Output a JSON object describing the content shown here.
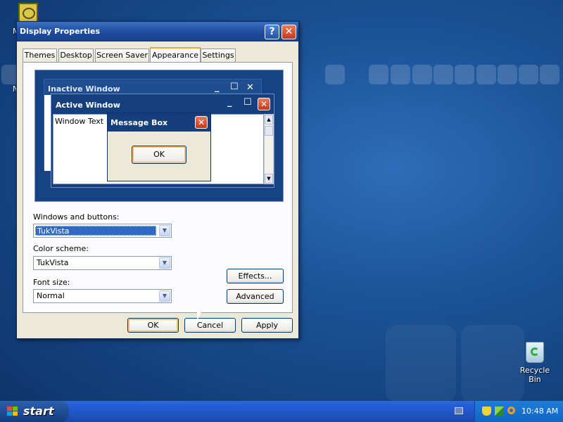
{
  "desktop": {
    "icons": [
      {
        "label": "M"
      },
      {
        "label": "N"
      }
    ],
    "recycle_bin": {
      "label": "Recycle Bin"
    }
  },
  "dialog": {
    "title": "Display Properties",
    "tabs": [
      {
        "label": "Themes"
      },
      {
        "label": "Desktop"
      },
      {
        "label": "Screen Saver"
      },
      {
        "label": "Appearance"
      },
      {
        "label": "Settings"
      }
    ],
    "active_tab": "Appearance",
    "preview": {
      "inactive_title": "Inactive Window",
      "active_title": "Active Window",
      "window_text": "Window Text",
      "message_box_title": "Message Box",
      "message_ok": "OK"
    },
    "windows_buttons": {
      "label": "Windows and buttons:",
      "value": "TukVista"
    },
    "color_scheme": {
      "label": "Color scheme:",
      "value": "TukVista"
    },
    "font_size": {
      "label": "Font size:",
      "value": "Normal"
    },
    "buttons": {
      "effects": "Effects...",
      "advanced": "Advanced",
      "ok": "OK",
      "cancel": "Cancel",
      "apply": "Apply"
    }
  },
  "taskbar": {
    "start_label": "start",
    "clock": "10:48 AM"
  },
  "colors": {
    "desktop": "#1c5499",
    "title_bar": "#1f4f9f",
    "dialog_face": "#ece9d8",
    "close_button": "#c2391b",
    "selection": "#316ac5"
  }
}
